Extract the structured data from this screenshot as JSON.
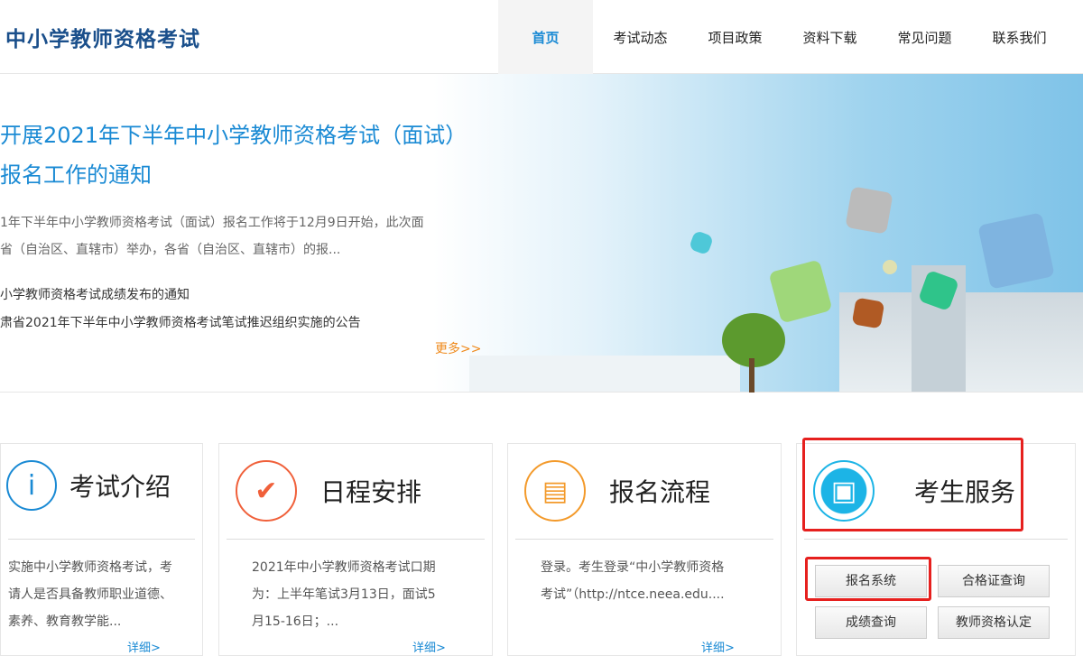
{
  "header": {
    "logo": "中小学教师资格考试",
    "nav": [
      "首页",
      "考试动态",
      "项目政策",
      "资料下载",
      "常见问题",
      "联系我们"
    ]
  },
  "banner": {
    "headline": "开展2021年下半年中小学教师资格考试（面试）报名工作的通知",
    "headline_line1": "开展2021年下半年中小学教师资格考试（面",
    "headline_line2": "报名工作的通知",
    "summary_line1": "1年下半年中小学教师资格考试（面试）报名工作将于12月9日开始，此次面",
    "summary_line2": "省（自治区、直辖市）举办，各省（自治区、直辖市）的报...",
    "news": [
      "小学教师资格考试成绩发布的通知",
      "肃省2021年下半年中小学教师资格考试笔试推迟组织实施的公告"
    ],
    "more": "更多>>"
  },
  "cards": [
    {
      "title": "考试介绍",
      "icon": "info-icon",
      "color": "#1a8ad4",
      "lines": [
        "实施中小学教师资格考试，考",
        "请人是否具备教师职业道德、",
        "素养、教育教学能..."
      ],
      "detail": "详细>"
    },
    {
      "title": "日程安排",
      "icon": "check-icon",
      "color": "#f0603a",
      "lines": [
        "2021年中小学教师资格考试口期",
        "为：上半年笔试3月13日，面试5",
        "月15-16日；..."
      ],
      "detail": "详细>"
    },
    {
      "title": "报名流程",
      "icon": "form-icon",
      "color": "#f39a2b",
      "lines": [
        "登录。考生登录“中小学教师资格",
        "考试”（http://ntce.neea.edu...."
      ],
      "detail": "详细>"
    },
    {
      "title": "考生服务",
      "icon": "contacts-icon",
      "color": "#1cb4e6",
      "buttons": [
        "报名系统",
        "合格证查询",
        "成绩查询",
        "教师资格认定"
      ]
    }
  ]
}
